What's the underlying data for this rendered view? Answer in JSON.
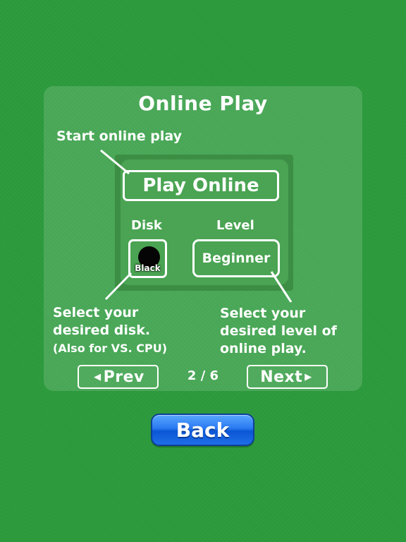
{
  "title": "Online Play",
  "callouts": {
    "start": "Start online play",
    "disk_line1": "Select your",
    "disk_line2": "desired disk.",
    "disk_line3": "(Also for VS. CPU)",
    "level_line1": "Select your",
    "level_line2": "desired level of",
    "level_line3": "online play."
  },
  "preview": {
    "play_online_label": "Play Online",
    "disk_label": "Disk",
    "level_label": "Level",
    "disk_value": "Black",
    "level_value": "Beginner"
  },
  "nav": {
    "prev_label": "Prev",
    "next_label": "Next",
    "page_indicator": "2 / 6"
  },
  "back_label": "Back",
  "colors": {
    "background": "#2c9a3c",
    "back_button": "#1f6ee8"
  }
}
